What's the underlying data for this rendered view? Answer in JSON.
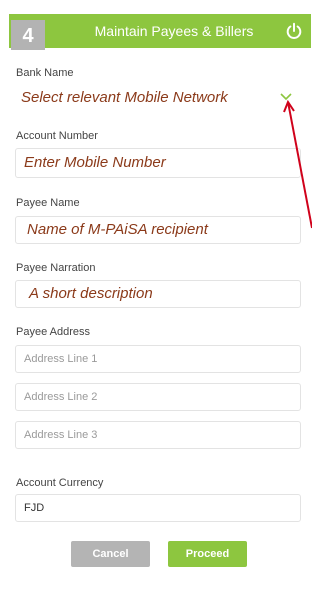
{
  "header": {
    "step_number": "4",
    "title": "Maintain Payees & Billers",
    "power_icon": "power-icon",
    "color": "#8dc63f"
  },
  "form": {
    "bank_name_label": "Bank Name",
    "bank_name_annotation": "Select relevant Mobile Network",
    "account_number_label": "Account Number",
    "account_number_annotation": "Enter Mobile Number",
    "payee_name_label": "Payee Name",
    "payee_name_annotation": "Name of M-PAiSA recipient",
    "payee_narration_label": "Payee Narration",
    "payee_narration_annotation": "A short description",
    "payee_address_label": "Payee Address",
    "address_line_1_placeholder": "Address Line 1",
    "address_line_2_placeholder": "Address Line 2",
    "address_line_3_placeholder": "Address Line 3",
    "account_currency_label": "Account Currency",
    "account_currency_value": "FJD"
  },
  "buttons": {
    "cancel_label": "Cancel",
    "proceed_label": "Proceed"
  },
  "annotation_color": "#8b3a1a",
  "arrow_color": "#d0021b"
}
